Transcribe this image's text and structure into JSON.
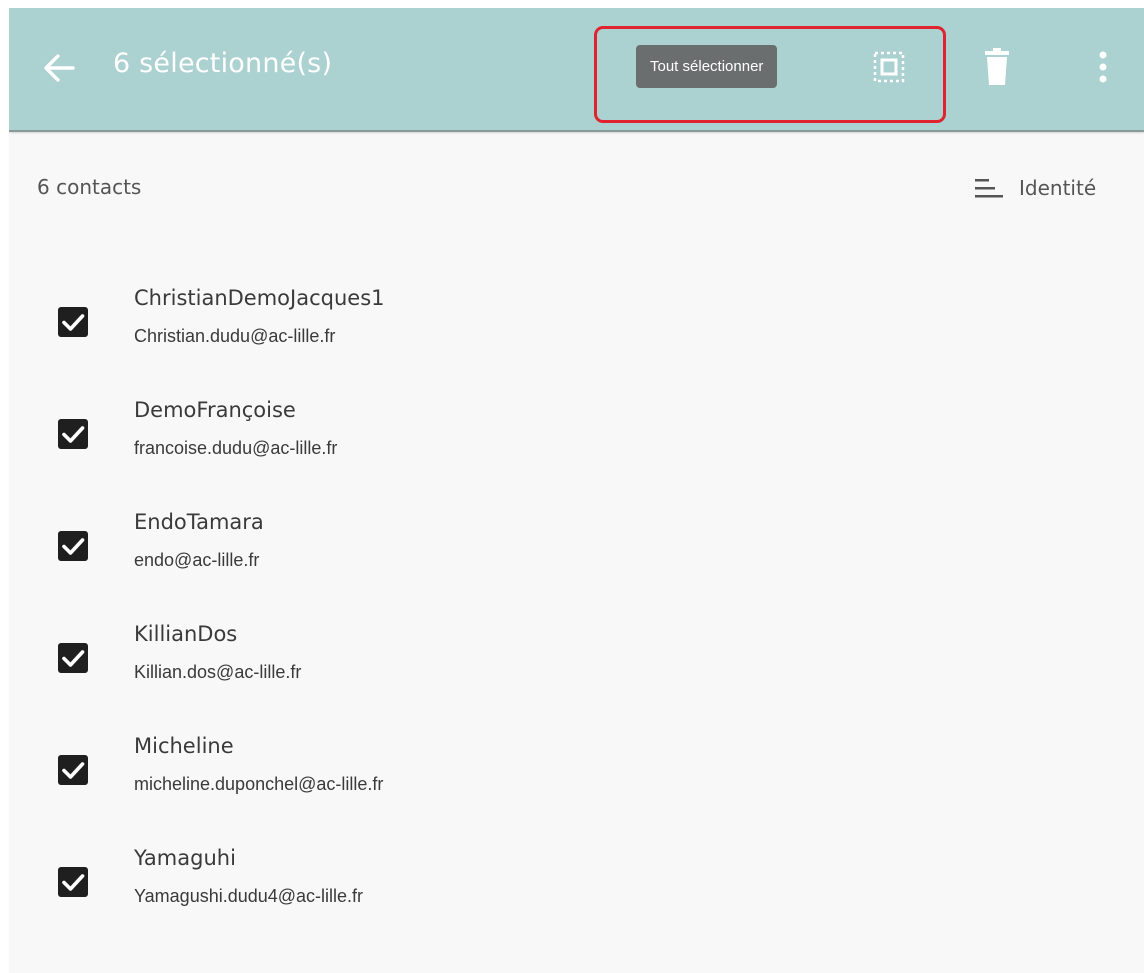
{
  "appbar": {
    "title": "6 sélectionné(s)",
    "tooltip": "Tout sélectionner",
    "back_icon": "arrow-left-icon",
    "select_all_icon": "select-all-icon",
    "delete_icon": "trash-icon",
    "more_icon": "more-vertical-icon",
    "background_color": "#abd1d0",
    "highlight_color": "#e0242f"
  },
  "list_header": {
    "count": "6 contacts",
    "sort_label": "Identité",
    "sort_icon": "sort-icon"
  },
  "contacts": [
    {
      "name": "ChristianDemoJacques1",
      "email": "Christian.dudu@ac-lille.fr",
      "checked": true
    },
    {
      "name": "DemoFrançoise",
      "email": "francoise.dudu@ac-lille.fr",
      "checked": true
    },
    {
      "name": "EndoTamara",
      "email": "endo@ac-lille.fr",
      "checked": true
    },
    {
      "name": "KillianDos",
      "email": "Killian.dos@ac-lille.fr",
      "checked": true
    },
    {
      "name": "Micheline",
      "email": "micheline.duponchel@ac-lille.fr",
      "checked": true
    },
    {
      "name": "Yamaguhi",
      "email": "Yamagushi.dudu4@ac-lille.fr",
      "checked": true
    }
  ]
}
